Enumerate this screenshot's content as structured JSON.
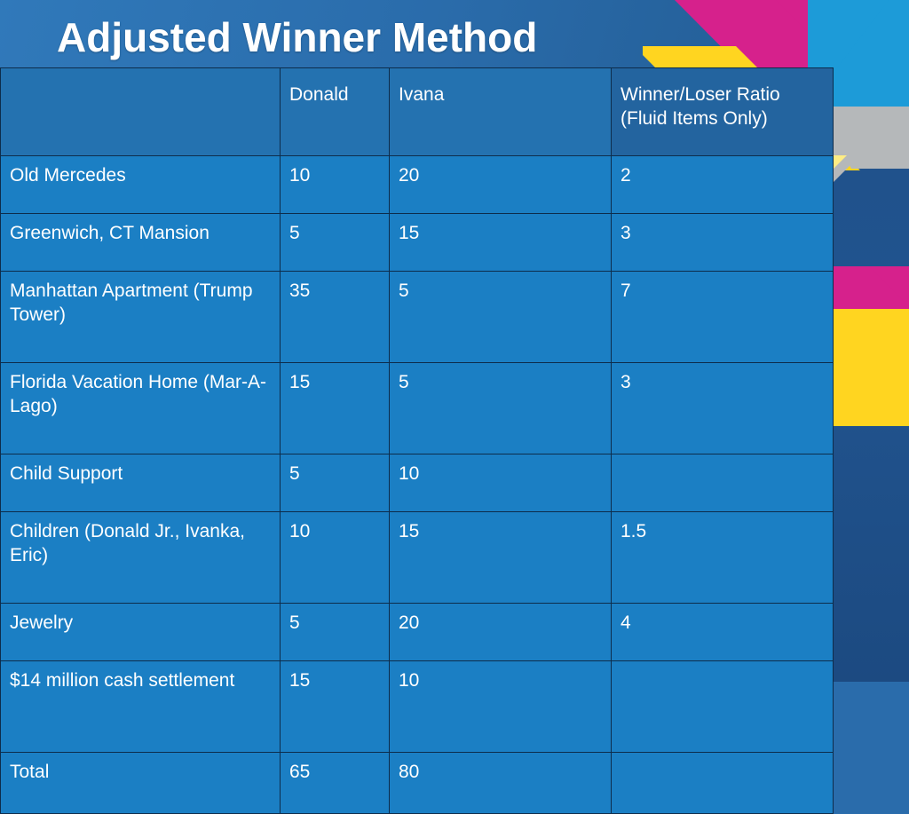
{
  "slide": {
    "title": "Adjusted Winner Method",
    "background_color": "#2a6cab",
    "table_cell_color": "#1b7fc4",
    "ratio_column_color": "#23649f",
    "accent_colors": {
      "red": "#e0705f",
      "green": "#b5d6a8",
      "purple": "#b3a8d6",
      "magenta": "#d6218c",
      "yellow": "#ffd520",
      "cyan": "#29a8e0",
      "gray": "#b5b8ba",
      "navy": "#1d4c84"
    }
  },
  "table": {
    "headers": [
      "",
      "Donald",
      "Ivana",
      "Winner/Loser Ratio (Fluid Items Only)"
    ],
    "header_ratio_line1": "Winner/Loser Ratio",
    "header_ratio_line2": "(Fluid Items Only)",
    "rows": [
      {
        "item": "Old Mercedes",
        "donald": "10",
        "donald_state": "red",
        "ivana": "20",
        "ivana_state": "green",
        "ratio": "2",
        "ratio_state": "plain"
      },
      {
        "item": "Greenwich, CT Mansion",
        "donald": "5",
        "donald_state": "red",
        "ivana": "15",
        "ivana_state": "green",
        "ratio": "3",
        "ratio_state": "plain"
      },
      {
        "item": "Manhattan Apartment (Trump Tower)",
        "donald": "35",
        "donald_state": "green",
        "ivana": "5",
        "ivana_state": "red",
        "ratio": "7",
        "ratio_state": "plain"
      },
      {
        "item": "Florida Vacation Home (Mar-A-Lago)",
        "donald": "15",
        "donald_state": "green",
        "ivana": "5",
        "ivana_state": "red",
        "ratio": "3",
        "ratio_state": "plain"
      },
      {
        "item": "Child Support",
        "donald": "5",
        "donald_state": "red",
        "ivana": "10",
        "ivana_state": "green",
        "ratio": "",
        "ratio_state": "plain"
      },
      {
        "item": "Children (Donald Jr., Ivanka, Eric)",
        "donald": "10",
        "donald_state": "red",
        "ivana": "15",
        "ivana_state": "green",
        "ratio": "1.5",
        "ratio_state": "purple"
      },
      {
        "item": "Jewelry",
        "donald": "5",
        "donald_state": "red",
        "ivana": "20",
        "ivana_state": "green",
        "ratio": "4",
        "ratio_state": "plain"
      },
      {
        "item": "$14 million cash settlement",
        "donald": "15",
        "donald_state": "green",
        "ivana": "10",
        "ivana_state": "red",
        "ratio": "",
        "ratio_state": "plain"
      },
      {
        "item": "Total",
        "donald": "65",
        "donald_state": "plain",
        "ivana": "80",
        "ivana_state": "plain",
        "ratio": "",
        "ratio_state": "plain"
      }
    ]
  }
}
